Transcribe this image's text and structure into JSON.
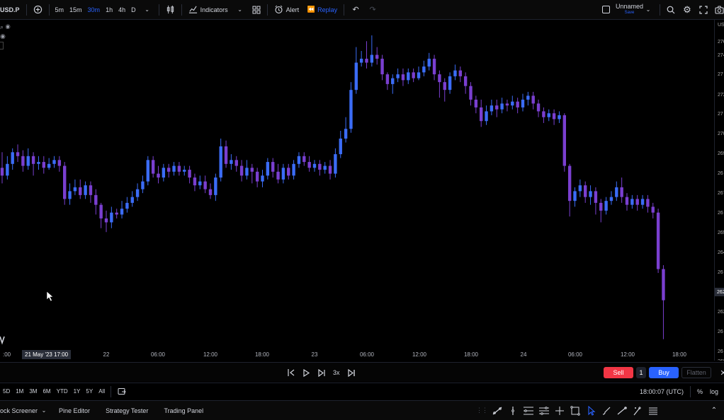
{
  "header": {
    "symbol": "USD.P",
    "intervals": [
      "5m",
      "15m",
      "30m",
      "1h",
      "4h",
      "D"
    ],
    "active_interval": "30m",
    "indicators_label": "Indicators",
    "alert_label": "Alert",
    "replay_label": "Replay",
    "layout_name": "Unnamed",
    "layout_status": "Save"
  },
  "legend": {
    "rows": [
      "⌕ ◉",
      "◉"
    ]
  },
  "colors": {
    "up": "#3b6cf6",
    "down": "#7a3fd0",
    "accent": "#2962ff",
    "sell": "#f23645",
    "buy": "#2962ff"
  },
  "price_axis": {
    "unit": "US",
    "labels": [
      "276",
      "274",
      "27",
      "272",
      "27",
      "270",
      "269",
      "26",
      "267",
      "26",
      "265",
      "264",
      "26",
      "262",
      "26",
      "26",
      "260"
    ],
    "current_value": "262"
  },
  "time_axis": {
    "labels": [
      ":00",
      "22",
      "06:00",
      "12:00",
      "18:00",
      "23",
      "06:00",
      "12:00",
      "18:00",
      "24",
      "06:00",
      "12:00",
      "18:00"
    ],
    "highlighted": "21 May '23 17:00"
  },
  "replay": {
    "speed": "3x",
    "sell_label": "Sell",
    "quantity": "1",
    "buy_label": "Buy",
    "flatten_label": "Flatten"
  },
  "ranges": {
    "items": [
      "5D",
      "1M",
      "3M",
      "6M",
      "YTD",
      "1Y",
      "5Y",
      "All"
    ],
    "clock": "18:00:07 (UTC)",
    "percent_label": "%",
    "log_label": "log"
  },
  "bottom": {
    "tabs": [
      "ock Screener",
      "Pine Editor",
      "Strategy Tester",
      "Trading Panel"
    ]
  },
  "chart_data": {
    "type": "candlestick",
    "title": "",
    "xlabel": "",
    "ylabel": "",
    "note": "values approximate; read from relative axis position",
    "ylim": [
      259.5,
      277.0
    ],
    "x_ticks": [
      "22",
      "23",
      "24"
    ],
    "candles": [
      [
        269.4,
        269.0,
        270.2,
        268.6
      ],
      [
        269.0,
        269.6,
        270.0,
        268.8
      ],
      [
        269.6,
        270.2,
        270.4,
        269.3
      ],
      [
        270.2,
        270.0,
        270.6,
        269.7
      ],
      [
        270.0,
        269.5,
        270.3,
        269.2
      ],
      [
        269.5,
        270.0,
        270.4,
        269.3
      ],
      [
        270.0,
        269.6,
        270.2,
        269.0
      ],
      [
        269.6,
        269.7,
        270.0,
        269.3
      ],
      [
        269.7,
        269.4,
        270.0,
        269.1
      ],
      [
        269.4,
        269.6,
        269.9,
        269.3
      ],
      [
        269.6,
        269.8,
        270.0,
        269.4
      ],
      [
        269.8,
        269.5,
        270.0,
        269.2
      ],
      [
        269.5,
        267.8,
        269.7,
        267.5
      ],
      [
        267.8,
        268.2,
        268.6,
        267.5
      ],
      [
        268.2,
        268.4,
        268.8,
        268.0
      ],
      [
        268.4,
        268.0,
        268.8,
        267.8
      ],
      [
        268.0,
        268.5,
        268.7,
        267.8
      ],
      [
        268.5,
        268.0,
        268.7,
        267.6
      ],
      [
        268.0,
        267.5,
        268.3,
        267.0
      ],
      [
        267.5,
        266.8,
        267.6,
        266.3
      ],
      [
        266.8,
        266.6,
        267.2,
        266.1
      ],
      [
        266.6,
        267.1,
        267.4,
        266.3
      ],
      [
        267.1,
        267.0,
        267.3,
        266.8
      ],
      [
        267.0,
        267.3,
        267.7,
        266.8
      ],
      [
        267.3,
        267.6,
        267.9,
        267.1
      ],
      [
        267.6,
        267.9,
        268.2,
        267.4
      ],
      [
        267.9,
        268.3,
        268.6,
        267.7
      ],
      [
        268.3,
        268.7,
        269.0,
        268.1
      ],
      [
        268.7,
        269.8,
        270.0,
        268.5
      ],
      [
        269.8,
        269.1,
        270.0,
        268.9
      ],
      [
        269.1,
        268.9,
        269.5,
        268.6
      ],
      [
        268.9,
        269.4,
        269.6,
        268.7
      ],
      [
        269.4,
        269.2,
        269.6,
        268.9
      ],
      [
        269.2,
        269.5,
        269.7,
        269.0
      ],
      [
        269.5,
        269.2,
        269.7,
        269.0
      ],
      [
        269.2,
        269.3,
        269.5,
        269.0
      ],
      [
        269.3,
        268.9,
        269.5,
        268.6
      ],
      [
        268.9,
        268.5,
        269.1,
        268.2
      ],
      [
        268.5,
        268.7,
        269.0,
        268.3
      ],
      [
        268.7,
        268.3,
        269.0,
        268.1
      ],
      [
        268.3,
        268.0,
        268.6,
        267.8
      ],
      [
        268.0,
        268.9,
        269.1,
        267.7
      ],
      [
        268.9,
        270.5,
        270.9,
        268.7
      ],
      [
        270.5,
        269.6,
        270.8,
        269.4
      ],
      [
        269.6,
        269.8,
        270.1,
        269.3
      ],
      [
        269.8,
        269.5,
        270.0,
        269.2
      ],
      [
        269.5,
        269.0,
        269.8,
        268.7
      ],
      [
        269.0,
        269.4,
        269.8,
        268.8
      ],
      [
        269.4,
        269.2,
        269.6,
        268.6
      ],
      [
        269.2,
        268.7,
        269.4,
        268.4
      ],
      [
        268.7,
        269.0,
        269.3,
        268.4
      ],
      [
        269.0,
        269.7,
        269.9,
        268.8
      ],
      [
        269.7,
        269.2,
        269.9,
        268.9
      ],
      [
        269.2,
        268.8,
        269.6,
        268.6
      ],
      [
        268.8,
        269.4,
        269.6,
        268.6
      ],
      [
        269.4,
        269.0,
        269.6,
        268.8
      ],
      [
        269.0,
        269.6,
        269.8,
        268.8
      ],
      [
        269.6,
        270.0,
        270.2,
        269.4
      ],
      [
        270.0,
        269.7,
        270.2,
        269.5
      ],
      [
        269.7,
        269.4,
        270.0,
        269.2
      ],
      [
        269.4,
        269.6,
        269.8,
        269.2
      ],
      [
        269.6,
        269.3,
        269.8,
        269.0
      ],
      [
        269.3,
        269.5,
        269.7,
        269.1
      ],
      [
        269.5,
        269.1,
        269.8,
        268.8
      ],
      [
        269.1,
        270.1,
        270.4,
        268.9
      ],
      [
        270.1,
        270.9,
        271.3,
        269.9
      ],
      [
        270.9,
        271.4,
        272.0,
        270.7
      ],
      [
        271.4,
        273.4,
        273.8,
        271.2
      ],
      [
        273.4,
        274.8,
        275.6,
        273.2
      ],
      [
        274.8,
        275.0,
        275.4,
        274.6
      ],
      [
        275.0,
        274.8,
        275.9,
        274.5
      ],
      [
        274.8,
        275.2,
        276.2,
        274.6
      ],
      [
        275.2,
        275.0,
        275.6,
        274.7
      ],
      [
        275.0,
        274.2,
        275.2,
        273.9
      ],
      [
        274.2,
        273.7,
        274.3,
        273.4
      ],
      [
        273.7,
        274.0,
        274.2,
        273.2
      ],
      [
        274.0,
        274.2,
        274.5,
        273.8
      ],
      [
        274.2,
        273.9,
        274.5,
        273.6
      ],
      [
        273.9,
        274.3,
        274.5,
        273.7
      ],
      [
        274.3,
        274.0,
        274.5,
        273.8
      ],
      [
        274.0,
        274.3,
        274.6,
        273.9
      ],
      [
        274.3,
        274.6,
        274.9,
        274.1
      ],
      [
        274.6,
        275.0,
        275.3,
        274.4
      ],
      [
        275.0,
        274.2,
        275.2,
        273.9
      ],
      [
        274.2,
        273.8,
        274.4,
        273.0
      ],
      [
        273.8,
        273.4,
        274.0,
        272.8
      ],
      [
        273.4,
        274.1,
        274.3,
        273.2
      ],
      [
        274.1,
        274.4,
        274.7,
        273.9
      ],
      [
        274.4,
        274.1,
        274.6,
        273.8
      ],
      [
        274.1,
        273.6,
        274.3,
        273.2
      ],
      [
        273.6,
        272.9,
        273.8,
        272.6
      ],
      [
        272.9,
        272.5,
        273.1,
        272.2
      ],
      [
        272.5,
        271.8,
        272.9,
        271.5
      ],
      [
        271.8,
        272.3,
        272.6,
        271.6
      ],
      [
        272.3,
        272.6,
        272.9,
        272.1
      ],
      [
        272.6,
        272.4,
        272.9,
        272.0
      ],
      [
        272.4,
        272.7,
        273.0,
        272.2
      ],
      [
        272.7,
        272.6,
        272.9,
        272.3
      ],
      [
        272.6,
        272.8,
        273.1,
        272.4
      ],
      [
        272.8,
        272.5,
        273.0,
        272.2
      ],
      [
        272.5,
        272.9,
        273.2,
        272.3
      ],
      [
        272.9,
        273.1,
        273.3,
        272.6
      ],
      [
        273.1,
        272.7,
        273.3,
        272.4
      ],
      [
        272.7,
        272.3,
        272.9,
        272.0
      ],
      [
        272.3,
        272.0,
        272.5,
        271.7
      ],
      [
        272.0,
        272.2,
        272.4,
        271.8
      ],
      [
        272.2,
        271.9,
        272.4,
        271.6
      ],
      [
        271.9,
        272.1,
        272.3,
        271.7
      ],
      [
        272.1,
        269.5,
        272.2,
        269.2
      ],
      [
        269.5,
        267.7,
        269.6,
        266.9
      ],
      [
        267.7,
        268.2,
        268.4,
        267.4
      ],
      [
        268.2,
        268.5,
        268.8,
        267.9
      ],
      [
        268.5,
        267.9,
        268.7,
        267.6
      ],
      [
        267.9,
        268.2,
        268.5,
        267.5
      ],
      [
        268.2,
        267.6,
        268.4,
        267.0
      ],
      [
        267.6,
        267.2,
        267.8,
        266.6
      ],
      [
        267.2,
        267.7,
        267.9,
        267.0
      ],
      [
        267.7,
        267.9,
        268.2,
        267.5
      ],
      [
        267.9,
        268.4,
        268.7,
        267.7
      ],
      [
        268.4,
        267.9,
        268.9,
        267.6
      ],
      [
        267.9,
        267.5,
        268.1,
        267.2
      ],
      [
        267.5,
        267.8,
        268.0,
        267.3
      ],
      [
        267.8,
        267.5,
        268.0,
        267.2
      ],
      [
        267.5,
        267.8,
        268.0,
        267.3
      ],
      [
        267.8,
        267.4,
        268.0,
        267.1
      ],
      [
        267.4,
        267.1,
        267.6,
        266.8
      ],
      [
        267.1,
        264.2,
        267.3,
        264.0
      ],
      [
        264.2,
        262.6,
        264.4,
        260.6
      ]
    ]
  }
}
